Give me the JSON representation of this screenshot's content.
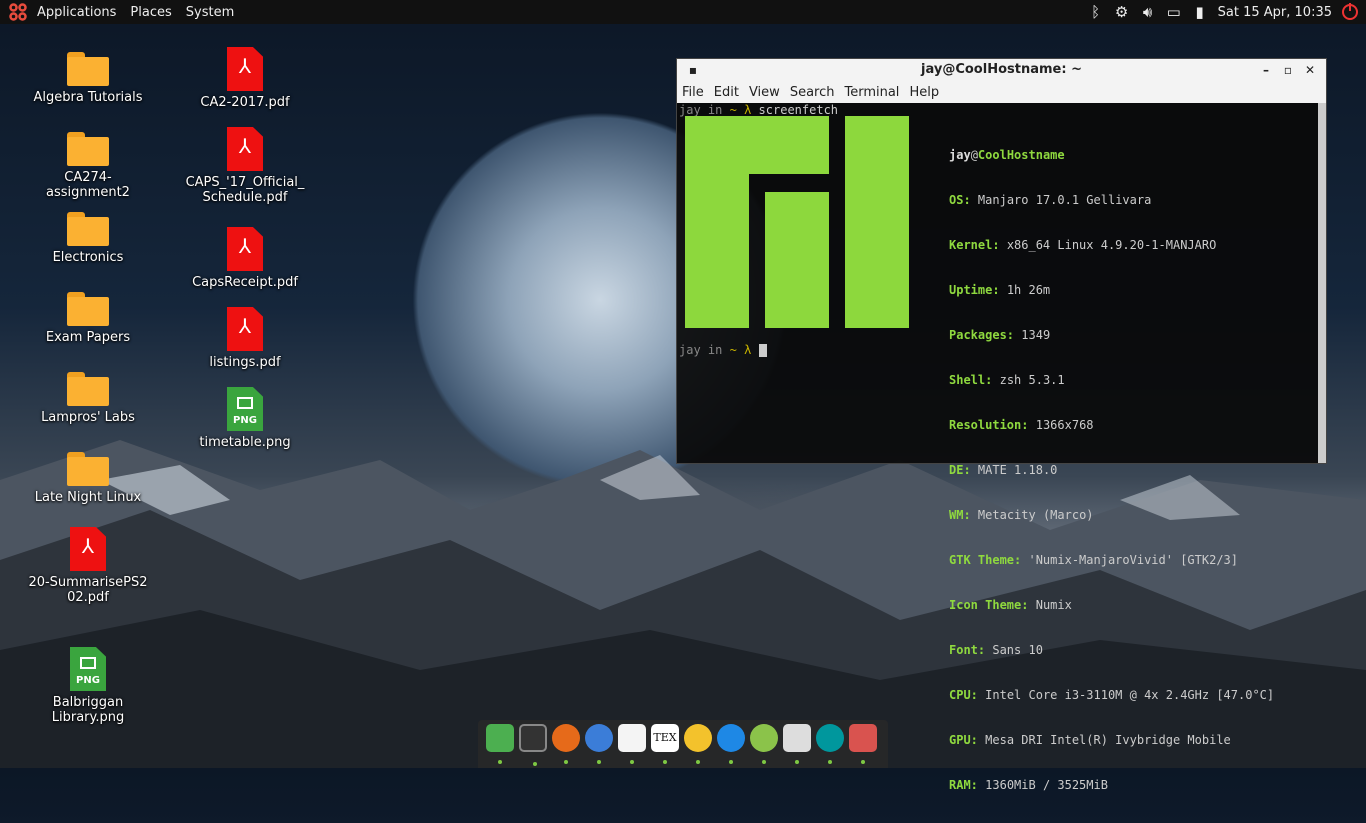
{
  "panel": {
    "menus": [
      "Applications",
      "Places",
      "System"
    ],
    "clock": "Sat 15 Apr, 10:35",
    "tray_icons": [
      "bluetooth-icon",
      "settings-icon",
      "volume-icon",
      "network-icon",
      "battery-icon",
      "power-icon"
    ]
  },
  "desktop": {
    "icons": [
      {
        "label": "Algebra Tutorials",
        "type": "folder"
      },
      {
        "label": "CA274-assignment2",
        "type": "folder"
      },
      {
        "label": "Electronics",
        "type": "folder"
      },
      {
        "label": "Exam Papers",
        "type": "folder"
      },
      {
        "label": "Lampros' Labs",
        "type": "folder"
      },
      {
        "label": "Late Night Linux",
        "type": "folder"
      },
      {
        "label": "20-SummarisePS202.pdf",
        "type": "pdf"
      },
      {
        "label": "Balbriggan Library.png",
        "type": "png"
      },
      {
        "label": "CA2-2017.pdf",
        "type": "pdf"
      },
      {
        "label": "CAPS_'17_Official_Schedule.pdf",
        "type": "pdf"
      },
      {
        "label": "CapsReceipt.pdf",
        "type": "pdf"
      },
      {
        "label": "listings.pdf",
        "type": "pdf"
      },
      {
        "label": "timetable.png",
        "type": "png"
      }
    ]
  },
  "terminal": {
    "title": "jay@CoolHostname: ~",
    "menu": [
      "File",
      "Edit",
      "View",
      "Search",
      "Terminal",
      "Help"
    ],
    "prompt_user": "jay",
    "prompt_in": "in",
    "prompt_dir": "~",
    "prompt_symbol": "λ",
    "command": "screenfetch",
    "user": "jay",
    "at": "@",
    "host": "CoolHostname",
    "info": [
      {
        "key": "OS:",
        "value": "Manjaro 17.0.1 Gellivara"
      },
      {
        "key": "Kernel:",
        "value": "x86_64 Linux 4.9.20-1-MANJARO"
      },
      {
        "key": "Uptime:",
        "value": "1h 26m"
      },
      {
        "key": "Packages:",
        "value": "1349"
      },
      {
        "key": "Shell:",
        "value": "zsh 5.3.1"
      },
      {
        "key": "Resolution:",
        "value": "1366x768"
      },
      {
        "key": "DE:",
        "value": "MATE 1.18.0"
      },
      {
        "key": "WM:",
        "value": "Metacity (Marco)"
      },
      {
        "key": "GTK Theme:",
        "value": "'Numix-ManjaroVivid' [GTK2/3]"
      },
      {
        "key": "Icon Theme:",
        "value": "Numix"
      },
      {
        "key": "Font:",
        "value": "Sans 10"
      },
      {
        "key": "CPU:",
        "value": "Intel Core i3-3110M @ 4x 2.4GHz [47.0°C]"
      },
      {
        "key": "GPU:",
        "value": "Mesa DRI Intel(R) Ivybridge Mobile"
      },
      {
        "key": "RAM:",
        "value": "1360MiB / 3525MiB"
      }
    ]
  },
  "dock": {
    "items": [
      "anchor-icon",
      "terminal-icon",
      "firefox-icon",
      "thunderbird-icon",
      "files-icon",
      "tex-icon",
      "teapot-icon",
      "sync-icon",
      "chrome-icon",
      "acrobat-icon",
      "arduino-icon",
      "trash-icon"
    ]
  },
  "colors": {
    "accent_green": "#8fd93f",
    "logo_green": "#8dd83d",
    "folder_orange": "#fbb132",
    "pdf_red": "#e11111",
    "png_green": "#3aa53e"
  }
}
